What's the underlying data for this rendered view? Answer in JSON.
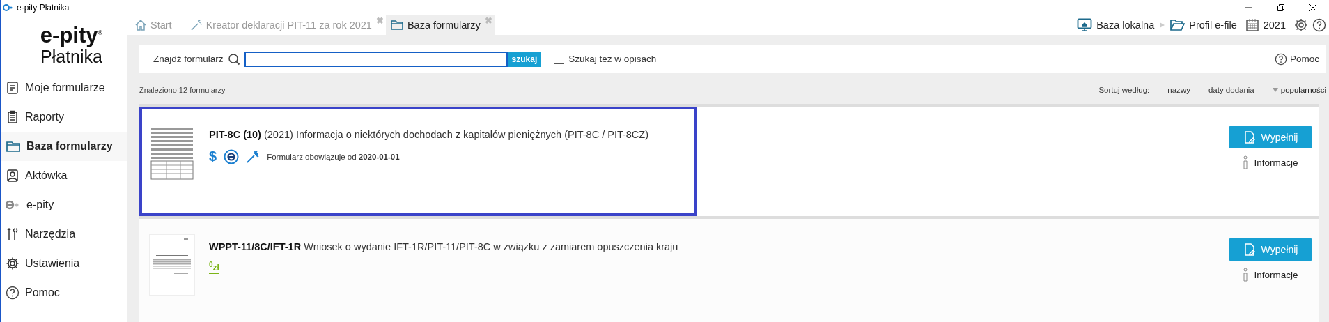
{
  "window": {
    "title": "e-pity Płatnika"
  },
  "logo": {
    "name": "e-pity",
    "mark": "®",
    "subtitle": "Płatnika"
  },
  "sidebar": {
    "items": [
      {
        "label": "Moje formularze",
        "selected": false
      },
      {
        "label": "Raporty",
        "selected": false
      },
      {
        "label": "Baza formularzy",
        "selected": true
      },
      {
        "label": "Aktówka",
        "selected": false
      },
      {
        "label": "e-pity",
        "selected": false
      },
      {
        "label": "Narzędzia",
        "selected": false
      },
      {
        "label": "Ustawienia",
        "selected": false
      },
      {
        "label": "Pomoc",
        "selected": false
      }
    ]
  },
  "tabs": [
    {
      "label": "Start",
      "selected": false
    },
    {
      "label": "Kreator deklaracji PIT-11 za rok 2021",
      "selected": false,
      "close": "✖"
    },
    {
      "label": "Baza formularzy",
      "selected": true,
      "close": "✖"
    }
  ],
  "toolbar": {
    "database": "Baza lokalna",
    "profile": "Profil e-file",
    "year": "2021"
  },
  "search": {
    "label": "Znajdź formularz",
    "button": "szukaj",
    "checkbox": {
      "label": "Szukaj też w opisach",
      "checked": false
    },
    "help": "Pomoc"
  },
  "results": {
    "count": "Znaleziono 12 formularzy",
    "sort_label": "Sortuj według:",
    "sort_options": [
      {
        "label": "nazwy",
        "selected": false
      },
      {
        "label": "daty dodania",
        "selected": false
      },
      {
        "label": "popularności",
        "selected": true
      }
    ]
  },
  "forms": [
    {
      "title": "**PIT-8C (10)** (2021) Informacja o niektórych dochodach z kapitałów pieniężnych (PIT-8C / PIT-8CZ)",
      "selected": true,
      "badges": [
        {
          "kind": "currency",
          "text": "$"
        },
        {
          "kind": "e-filing"
        },
        {
          "kind": "wizard"
        }
      ],
      "valid_from": "Formularz obowiązuje od **2020-01-01**",
      "fill_button": "Wypełnij",
      "info_link": "Informacje"
    },
    {
      "title": "**WPPT-11/8C/IFT-1R** Wniosek o wydanie IFT-1R/PIT-11/PIT-8C w związku z zamiarem opuszczenia kraju",
      "selected": false,
      "badges": [
        {
          "kind": "price",
          "text": "$^{0}$zł"
        }
      ],
      "fill_button": "Wypełnij",
      "info_link": "Informacje"
    }
  ]
}
